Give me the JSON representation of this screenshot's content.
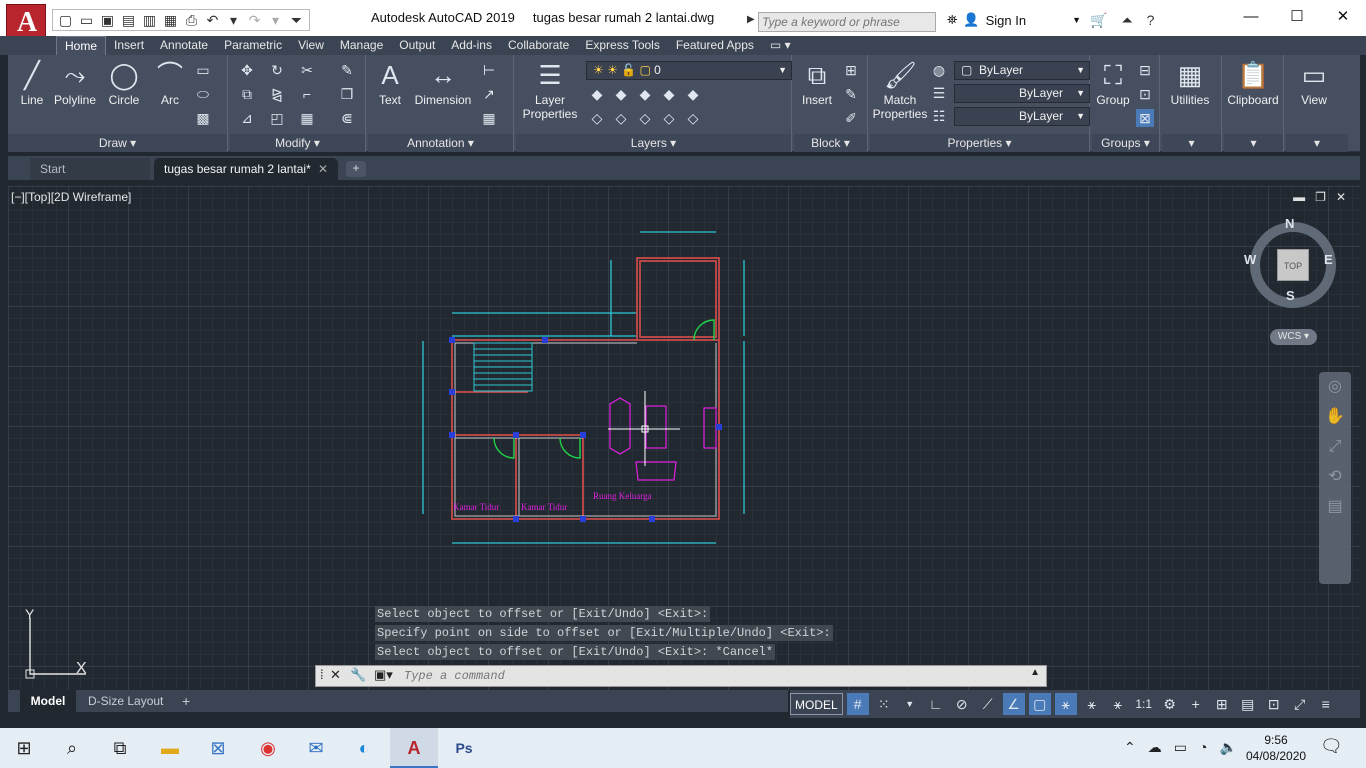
{
  "titlebar": {
    "app_name": "Autodesk AutoCAD 2019",
    "file_name": "tugas besar rumah 2 lantai.dwg",
    "search_placeholder": "Type a keyword or phrase",
    "signin_label": "Sign In",
    "app_letter": "A"
  },
  "ribbon": {
    "tabs": [
      "Home",
      "Insert",
      "Annotate",
      "Parametric",
      "View",
      "Manage",
      "Output",
      "Add-ins",
      "Collaborate",
      "Express Tools",
      "Featured Apps"
    ],
    "active_tab": "Home",
    "draw": {
      "title": "Draw",
      "line": "Line",
      "polyline": "Polyline",
      "circle": "Circle",
      "arc": "Arc"
    },
    "modify": {
      "title": "Modify"
    },
    "annotation": {
      "title": "Annotation",
      "text": "Text",
      "dimension": "Dimension"
    },
    "layers": {
      "title": "Layers",
      "layer_properties_1": "Layer",
      "layer_properties_2": "Properties",
      "current_layer": "0"
    },
    "block": {
      "title": "Block",
      "insert": "Insert"
    },
    "properties": {
      "title": "Properties",
      "match_1": "Match",
      "match_2": "Properties",
      "color": "ByLayer",
      "linetype": "ByLayer",
      "lineweight": "ByLayer"
    },
    "groups": {
      "title": "Groups",
      "group": "Group"
    },
    "utilities": "Utilities",
    "clipboard": "Clipboard",
    "view": "View"
  },
  "doc_tabs": {
    "start": "Start",
    "drawing": "tugas besar rumah 2 lantai*"
  },
  "viewport": {
    "label": "[−][Top][2D Wireframe]",
    "viewcube": {
      "top": "TOP",
      "n": "N",
      "s": "S",
      "e": "E",
      "w": "W"
    },
    "wcs": "WCS"
  },
  "drawing": {
    "room1": "Kamar Tidur",
    "room2": "Kamar Tidur",
    "room3": "Ruang Keluarga"
  },
  "ucs": {
    "x": "X",
    "y": "Y"
  },
  "command": {
    "history": [
      "Select object to offset or [Exit/Undo] <Exit>:",
      "Specify point on side to offset or [Exit/Multiple/Undo] <Exit>:",
      "Select object to offset or [Exit/Undo] <Exit>: *Cancel*"
    ],
    "placeholder": "Type a command"
  },
  "layout_tabs": {
    "model": "Model",
    "layout": "D-Size Layout"
  },
  "status": {
    "model": "MODEL",
    "scale": "1:1"
  },
  "taskbar": {
    "time": "9:56",
    "date": "04/08/2020"
  },
  "colors": {
    "accent": "#4a7ab8",
    "canvas": "#212830",
    "ribbon": "#454f60",
    "wall": "#c84a4a",
    "cyan": "#2ec7d4",
    "magenta": "#e020e0"
  }
}
